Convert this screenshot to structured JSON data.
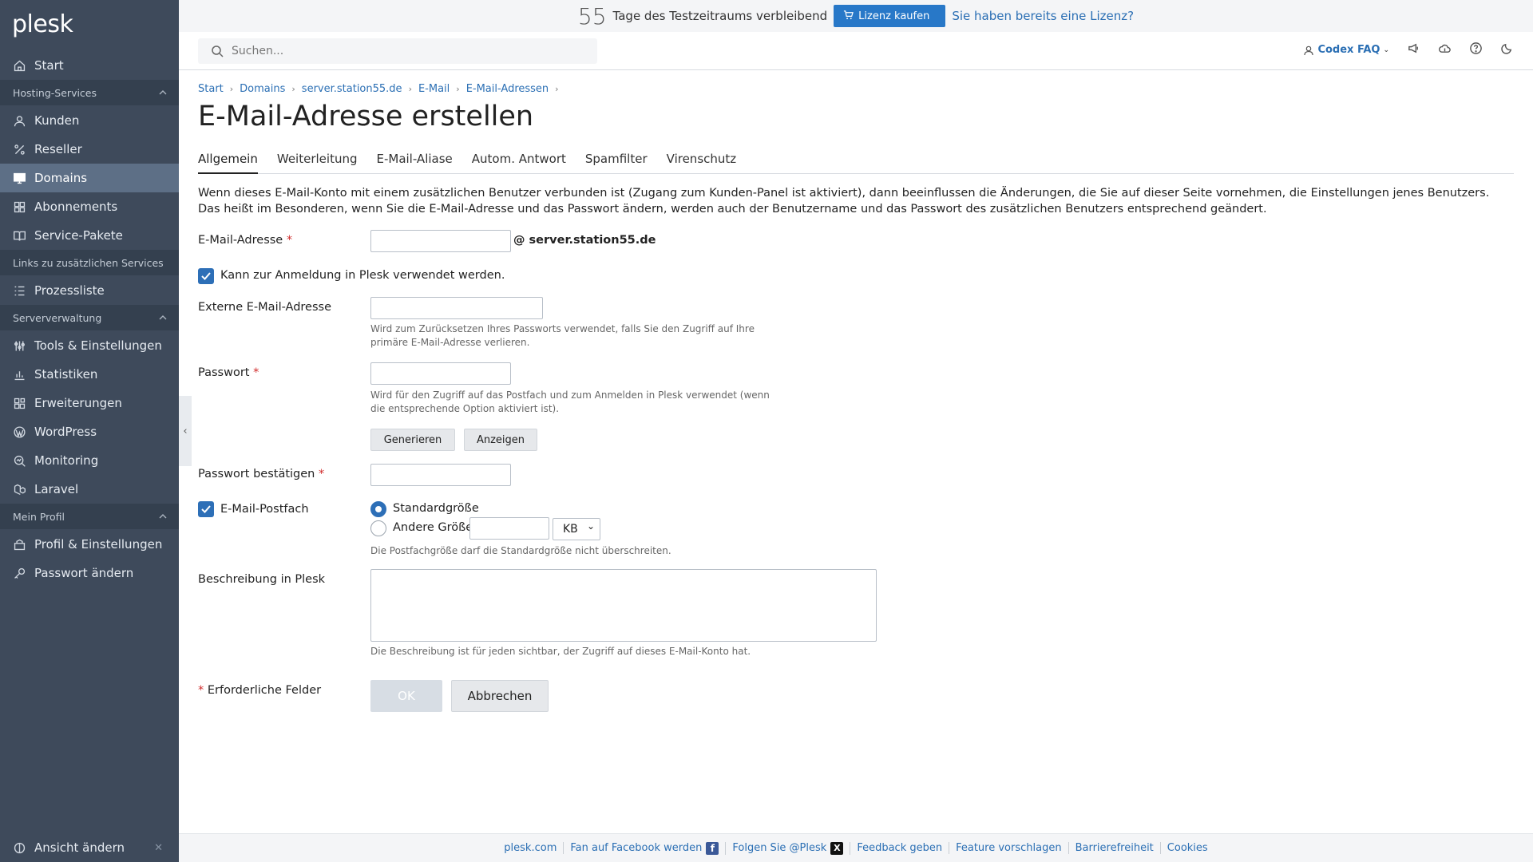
{
  "app": {
    "logo": "plesk"
  },
  "topbar": {
    "trial_days": "55",
    "trial_text": "Tage des Testzeitraums verbleibend",
    "buy_label": "Lizenz kaufen",
    "have_license": "Sie haben bereits eine Lizenz?"
  },
  "header": {
    "search_placeholder": "Suchen...",
    "user_label": "Codex FAQ"
  },
  "sidebar": {
    "start": "Start",
    "sections": {
      "hosting": "Hosting-Services",
      "links": "Links zu zusätzlichen Services",
      "server": "Serververwaltung",
      "profile": "Mein Profil"
    },
    "items": {
      "kunden": "Kunden",
      "reseller": "Reseller",
      "domains": "Domains",
      "abonnements": "Abonnements",
      "service_pakete": "Service-Pakete",
      "prozessliste": "Prozessliste",
      "tools": "Tools & Einstellungen",
      "statistiken": "Statistiken",
      "erweiterungen": "Erweiterungen",
      "wordpress": "WordPress",
      "monitoring": "Monitoring",
      "laravel": "Laravel",
      "profil": "Profil & Einstellungen",
      "passwort": "Passwort ändern"
    },
    "view_change": "Ansicht ändern"
  },
  "breadcrumb": [
    "Start",
    "Domains",
    "server.station55.de",
    "E-Mail",
    "E-Mail-Adressen"
  ],
  "page_title": "E-Mail-Adresse erstellen",
  "tabs": [
    "Allgemein",
    "Weiterleitung",
    "E-Mail-Aliase",
    "Autom. Antwort",
    "Spamfilter",
    "Virenschutz"
  ],
  "info_text": "Wenn dieses E-Mail-Konto mit einem zusätzlichen Benutzer verbunden ist (Zugang zum Kunden-Panel ist aktiviert), dann beeinflussen die Änderungen, die Sie auf dieser Seite vornehmen, die Einstellungen jenes Benutzers. Das heißt im Besonderen, wenn Sie die E-Mail-Adresse und das Passwort ändern, werden auch der Benutzername und das Passwort des zusätzlichen Benutzers entsprechend geändert.",
  "form": {
    "email_label": "E-Mail-Adresse",
    "email_domain": "@ server.station55.de",
    "login_checkbox": "Kann zur Anmeldung in Plesk verwendet werden.",
    "external_label": "Externe E-Mail-Adresse",
    "external_hint": "Wird zum Zurücksetzen Ihres Passworts verwendet, falls Sie den Zugriff auf Ihre primäre E-Mail-Adresse verlieren.",
    "password_label": "Passwort",
    "password_hint": "Wird für den Zugriff auf das Postfach und zum Anmelden in Plesk verwendet (wenn die entsprechende Option aktiviert ist).",
    "generate_btn": "Generieren",
    "show_btn": "Anzeigen",
    "confirm_label": "Passwort bestätigen",
    "mailbox_label": "E-Mail-Postfach",
    "size_default": "Standardgröße",
    "size_other": "Andere Größe",
    "size_unit": "KB",
    "size_hint": "Die Postfachgröße darf die Standardgröße nicht überschreiten.",
    "desc_label": "Beschreibung in Plesk",
    "desc_hint": "Die Beschreibung ist für jeden sichtbar, der Zugriff auf dieses E-Mail-Konto hat.",
    "required_note": "Erforderliche Felder",
    "ok_btn": "OK",
    "cancel_btn": "Abbrechen",
    "req_mark": "*"
  },
  "footer": {
    "plesk": "plesk.com",
    "facebook": "Fan auf Facebook werden",
    "twitter": "Folgen Sie @Plesk",
    "feedback": "Feedback geben",
    "feature": "Feature vorschlagen",
    "accessibility": "Barrierefreiheit",
    "cookies": "Cookies"
  },
  "colors": {
    "sidebar_bg": "#3e4a5b",
    "sidebar_active": "#5d6f86",
    "accent": "#2878c8",
    "link": "#2b6fb4",
    "required": "#d02b2b"
  }
}
